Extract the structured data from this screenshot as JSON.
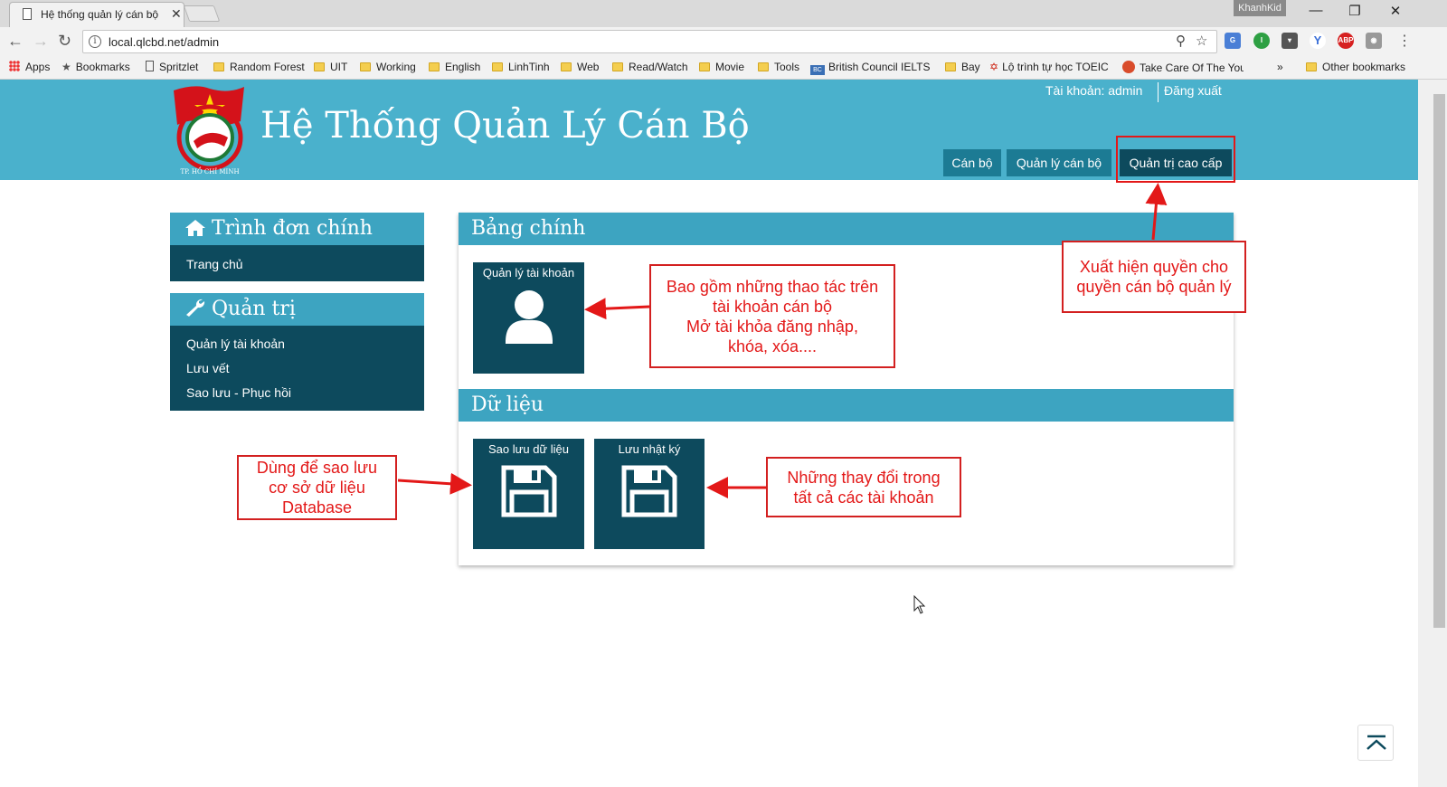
{
  "browser": {
    "tab_title": "Hệ thống quản lý cán bộ",
    "tab_close": "✕",
    "profile": "KhanhKid",
    "url": "local.qlcbd.net/admin",
    "bookmarks": [
      "Apps",
      "Bookmarks",
      "Spritzlet",
      "Random Forest",
      "UIT",
      "Working",
      "English",
      "LinhTinh",
      "Web",
      "Read/Watch",
      "Movie",
      "Tools",
      "British Council IELTS C",
      "Bay",
      "Lộ trình tự học TOEIC",
      "Take Care Of The Your",
      "»",
      "Other bookmarks"
    ],
    "extensions": [
      "translate",
      "ieee",
      "pocket",
      "vpn",
      "abp",
      "camera"
    ]
  },
  "site": {
    "title": "Hệ Thống Quản Lý Cán Bộ",
    "logo_text": "TP. HỒ CHÍ MINH",
    "account_label": "Tài khoản: admin",
    "logout_label": "Đăng xuất",
    "nav": [
      "Cán bộ",
      "Quản lý cán bộ",
      "Quản trị cao cấp"
    ],
    "accent_color": "#4ab1cc",
    "dark_color": "#0d4a5d"
  },
  "sidebar": {
    "main_menu_title": "Trình đơn chính",
    "main_menu_items": [
      "Trang chủ"
    ],
    "admin_title": "Quản trị",
    "admin_items": [
      "Quản lý tài khoản",
      "Lưu vết",
      "Sao lưu - Phục hồi"
    ]
  },
  "main": {
    "dashboard_title": "Bảng chính",
    "data_title": "Dữ liệu",
    "tiles": [
      {
        "label": "Quản lý tài khoản",
        "icon": "user-icon"
      },
      {
        "label": "Sao lưu dữ liệu",
        "icon": "floppy-disk-icon"
      },
      {
        "label": "Lưu nhật ký",
        "icon": "floppy-disk-icon"
      }
    ]
  },
  "annotations": {
    "account_note": [
      "Bao gồm những thao tác trên",
      "tài khoản cán bộ",
      "Mở tài khỏa đăng nhập,",
      "khóa, xóa...."
    ],
    "permission_note": [
      "Xuất hiện quyền cho",
      "quyền cán bộ quản lý"
    ],
    "backup_note": [
      "Dùng để sao lưu",
      "cơ sở dữ liệu",
      "Database"
    ],
    "log_note": [
      "Những thay đổi trong",
      "tất cả các tài khoản"
    ],
    "color": "#e31818"
  }
}
